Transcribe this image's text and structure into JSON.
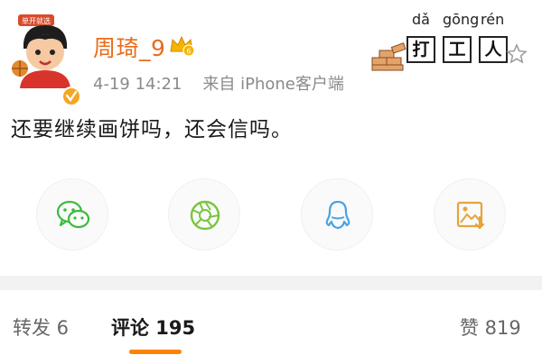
{
  "post": {
    "username": "周琦_9",
    "timestamp": "4-19 14:21",
    "source": "来自 iPhone客户端",
    "text": "还要继续画饼吗，还会信吗。",
    "avatar_tag": "单开就选",
    "badges": {
      "crown": "crown-icon",
      "verified": "verified-badge-icon"
    }
  },
  "sticker": {
    "pinyin": [
      "dǎ",
      "gōng",
      "rén"
    ],
    "chars": [
      "打",
      "工",
      "人"
    ]
  },
  "share": [
    {
      "name": "wechat",
      "icon": "wechat-icon",
      "color": "#3dbb3d"
    },
    {
      "name": "moments",
      "icon": "moments-shutter-icon",
      "color": "#78c63e"
    },
    {
      "name": "qq",
      "icon": "qq-penguin-icon",
      "color": "#4aa3e3"
    },
    {
      "name": "save-image",
      "icon": "image-save-icon",
      "color": "#e8a33a"
    }
  ],
  "tabs": {
    "repost": "转发 6",
    "comments": "评论 195",
    "likes": "赞 819"
  },
  "colors": {
    "accent": "#ff8200",
    "username": "#e86c1b",
    "meta": "#8a8a8a"
  }
}
